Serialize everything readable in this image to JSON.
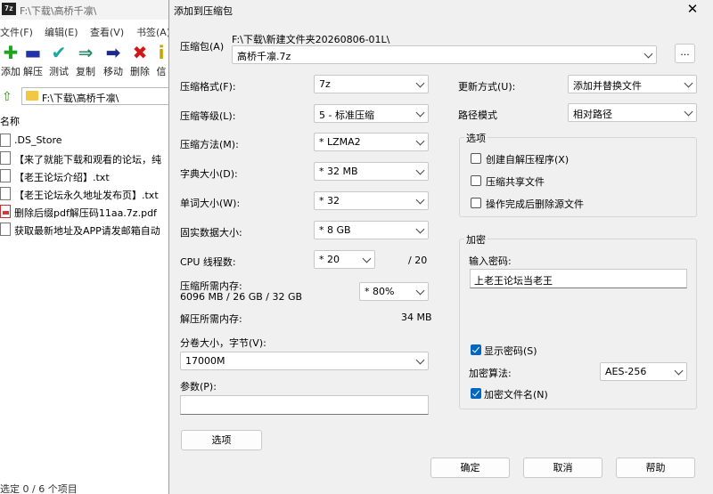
{
  "background": {
    "title": "F:\\下载\\高桥千凛\\",
    "app_icon": "7z",
    "menu": [
      "文件(F)",
      "编辑(E)",
      "查看(V)",
      "书签(A)"
    ],
    "toolbar": [
      {
        "icon": "add-icon",
        "glyph": "✚",
        "color": "#1fa31f",
        "label": "添加"
      },
      {
        "icon": "extract-icon",
        "glyph": "▬",
        "color": "#2233aa",
        "label": "解压"
      },
      {
        "icon": "test-icon",
        "glyph": "✔",
        "color": "#1aa6a6",
        "label": "测试"
      },
      {
        "icon": "copy-icon",
        "glyph": "⇒",
        "color": "#2a8a6a",
        "label": "复制"
      },
      {
        "icon": "move-icon",
        "glyph": "➡",
        "color": "#1c2a8a",
        "label": "移动"
      },
      {
        "icon": "delete-icon",
        "glyph": "✖",
        "color": "#d01818",
        "label": "删除"
      },
      {
        "icon": "info-icon",
        "glyph": "i",
        "color": "#c9a400",
        "label": "信"
      }
    ],
    "address": "F:\\下载\\高桥千凛\\",
    "column_name": "名称",
    "files": [
      {
        "name": ".DS_Store",
        "type": "file"
      },
      {
        "name": "【来了就能下载和观看的论坛，纯",
        "type": "file"
      },
      {
        "name": "【老王论坛介绍】.txt",
        "type": "file"
      },
      {
        "name": "【老王论坛永久地址发布页】.txt",
        "type": "file"
      },
      {
        "name": "删除后缀pdf解压码11aa.7z.pdf",
        "type": "pdf"
      },
      {
        "name": "获取最新地址及APP请发邮箱自动",
        "type": "file"
      }
    ],
    "status": "选定 0 / 6 个项目"
  },
  "dialog": {
    "title": "添加到压缩包",
    "close": "✕",
    "archive_label": "压缩包(A)",
    "archive_path": "F:\\下载\\新建文件夹20260806-01L\\",
    "archive_name": "高桥千凛.7z",
    "browse": "...",
    "format_label": "压缩格式(F):",
    "format_value": "7z",
    "level_label": "压缩等级(L):",
    "level_value": "5 - 标准压缩",
    "method_label": "压缩方法(M):",
    "method_value": "* LZMA2",
    "dict_label": "字典大小(D):",
    "dict_value": "* 32 MB",
    "word_label": "单词大小(W):",
    "word_value": "* 32",
    "solid_label": "固实数据大小:",
    "solid_value": "* 8 GB",
    "cpu_label": "CPU 线程数:",
    "cpu_value": "* 20",
    "cpu_total": "/ 20",
    "mem_comp_label": "压缩所需内存:",
    "mem_comp_value": "6096 MB / 26 GB / 32 GB",
    "mem_pct_value": "* 80%",
    "mem_decomp_label": "解压所需内存:",
    "mem_decomp_value": "34 MB",
    "volume_label": "分卷大小，字节(V):",
    "volume_value": "17000M",
    "params_label": "参数(P):",
    "params_value": "",
    "options_button": "选项",
    "update_label": "更新方式(U):",
    "update_value": "添加并替换文件",
    "path_label": "路径模式",
    "path_value": "相对路径",
    "options_group": {
      "title": "选项",
      "items": [
        {
          "label": "创建自解压程序(X)",
          "checked": false
        },
        {
          "label": "压缩共享文件",
          "checked": false
        },
        {
          "label": "操作完成后删除源文件",
          "checked": false
        }
      ]
    },
    "encrypt_group": {
      "title": "加密",
      "password_label": "输入密码:",
      "password_value": "上老王论坛当老王",
      "show_password": "显示密码(S)",
      "show_password_checked": true,
      "method_label": "加密算法:",
      "method_value": "AES-256",
      "encrypt_names": "加密文件名(N)",
      "encrypt_names_checked": true
    },
    "ok": "确定",
    "cancel": "取消",
    "help": "帮助"
  }
}
